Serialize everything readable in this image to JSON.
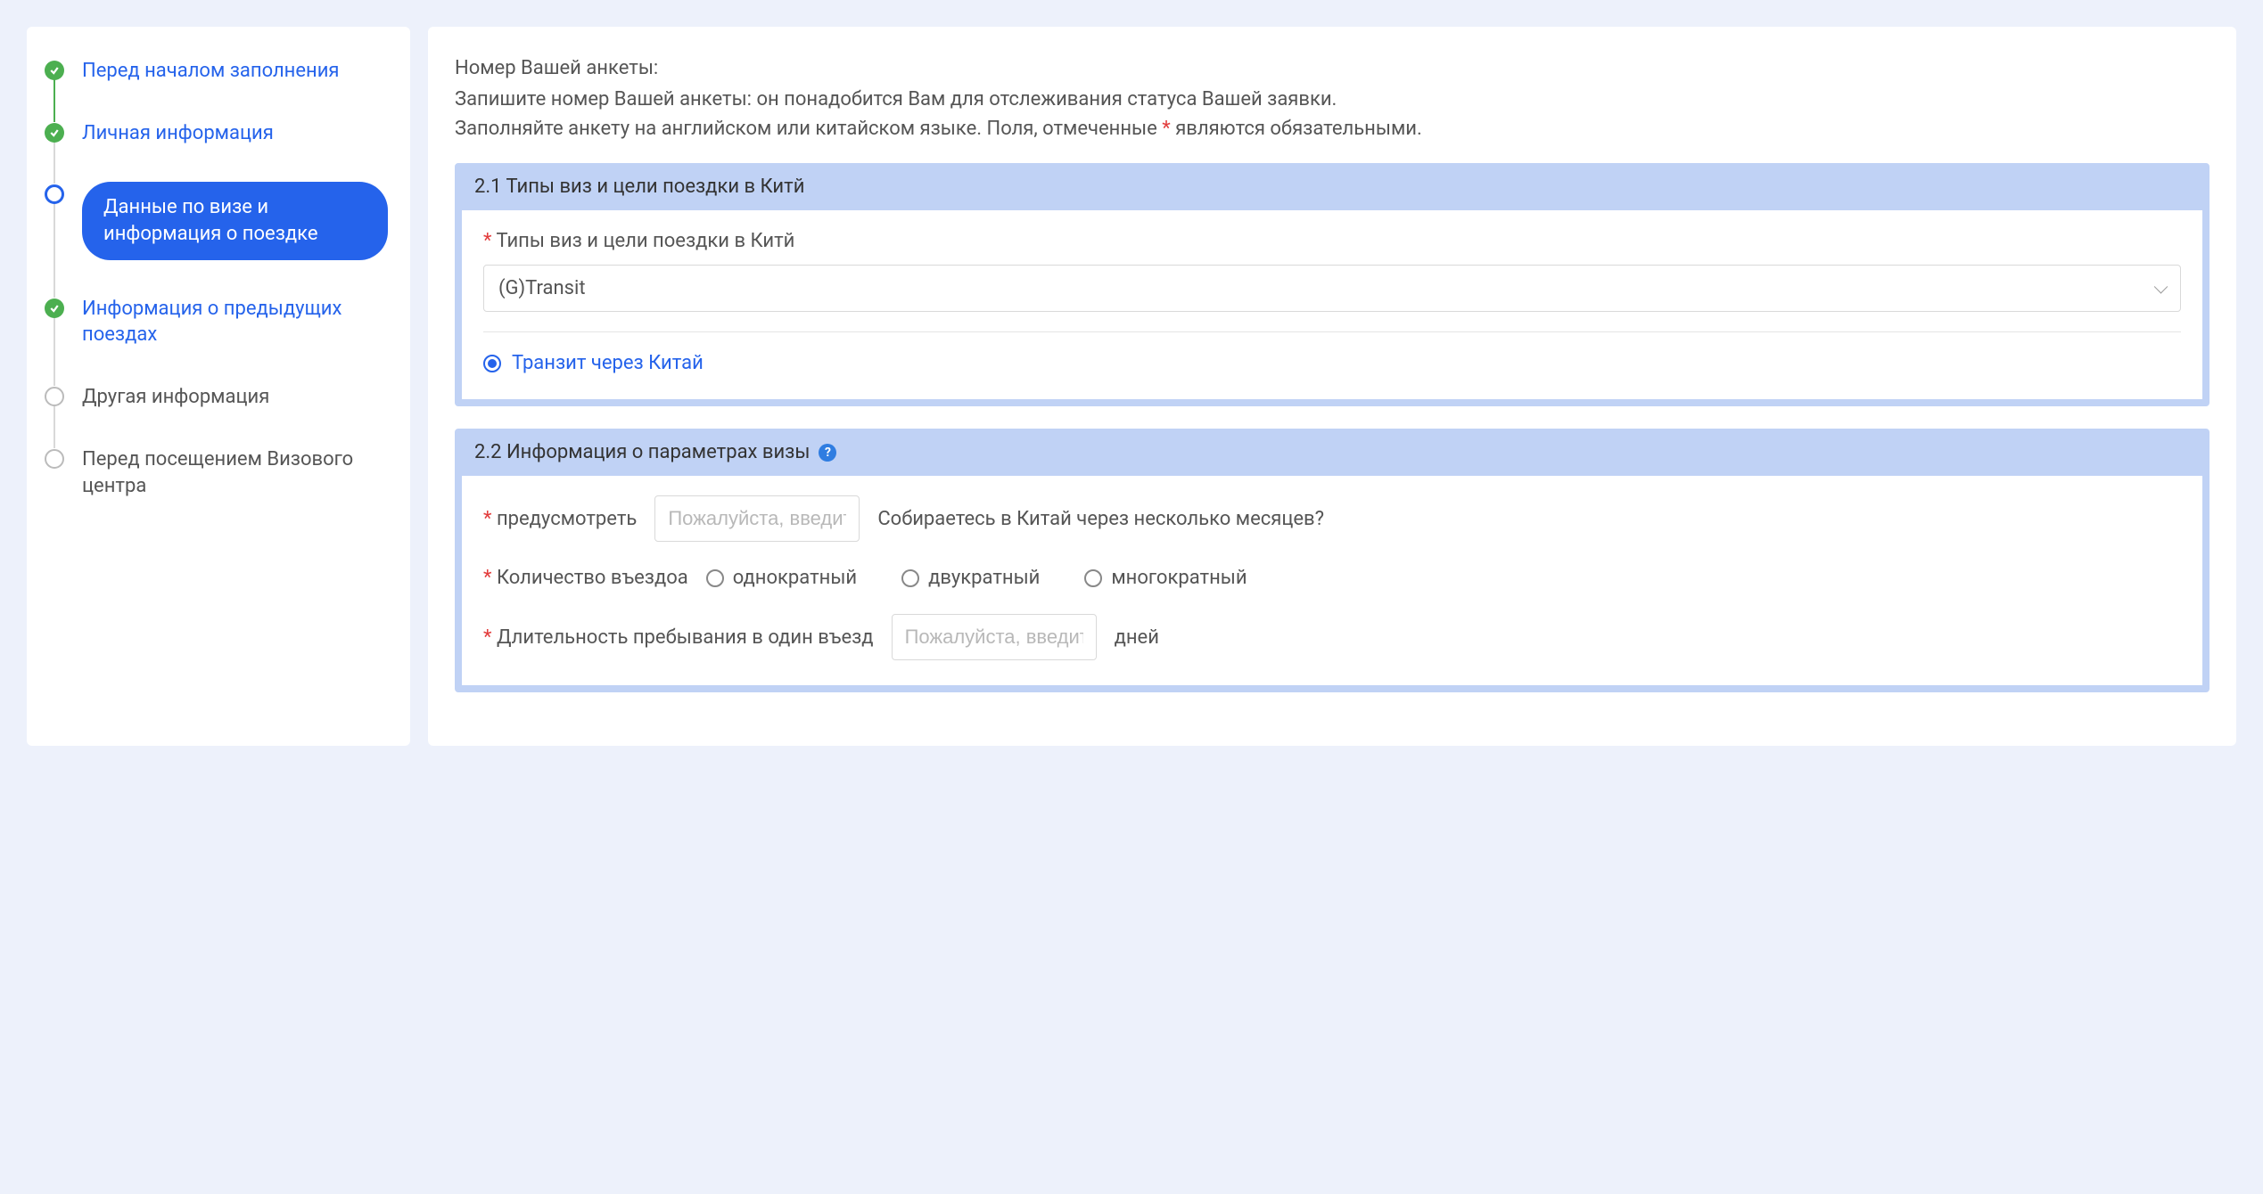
{
  "sidebar": {
    "steps": [
      {
        "label": "Перед началом заполнения",
        "status": "completed"
      },
      {
        "label": "Личная информация",
        "status": "completed"
      },
      {
        "label": "Данные по визе и информация о поездке",
        "status": "current"
      },
      {
        "label": "Информация о предыдущих поездах",
        "status": "completed"
      },
      {
        "label": "Другая информация",
        "status": "pending"
      },
      {
        "label": "Перед посещением Визового центра",
        "status": "pending"
      }
    ]
  },
  "intro": {
    "label": "Номер Вашей анкеты:",
    "line1": "Запишите номер Вашей анкеты: он понадобится Вам для отслеживания статуса Вашей заявки.",
    "line2_before": "Заполняйте анкету на английском или китайском языке. Поля, отмеченные ",
    "line2_star": "*",
    "line2_after": " являются обязательными."
  },
  "section1": {
    "title": "2.1 Типы виз и цели поездки в Китй",
    "field_label": "Типы виз и цели поездки в Китй",
    "select_value": "(G)Transit",
    "radio_label": "Транзит через Китай"
  },
  "section2": {
    "title": "2.2 Информация о параметрах визы",
    "row1": {
      "label": "предусмотреть",
      "placeholder": "Пожалуйста, введите",
      "hint": "Собираетесь в Китай через несколько месяцев?"
    },
    "row2": {
      "label": "Количество въездоа",
      "opt1": "однократный",
      "opt2": "двукратный",
      "opt3": "многократный"
    },
    "row3": {
      "label": "Длительность пребывания в один въезд",
      "placeholder": "Пожалуйста, введите",
      "suffix": "дней"
    }
  }
}
